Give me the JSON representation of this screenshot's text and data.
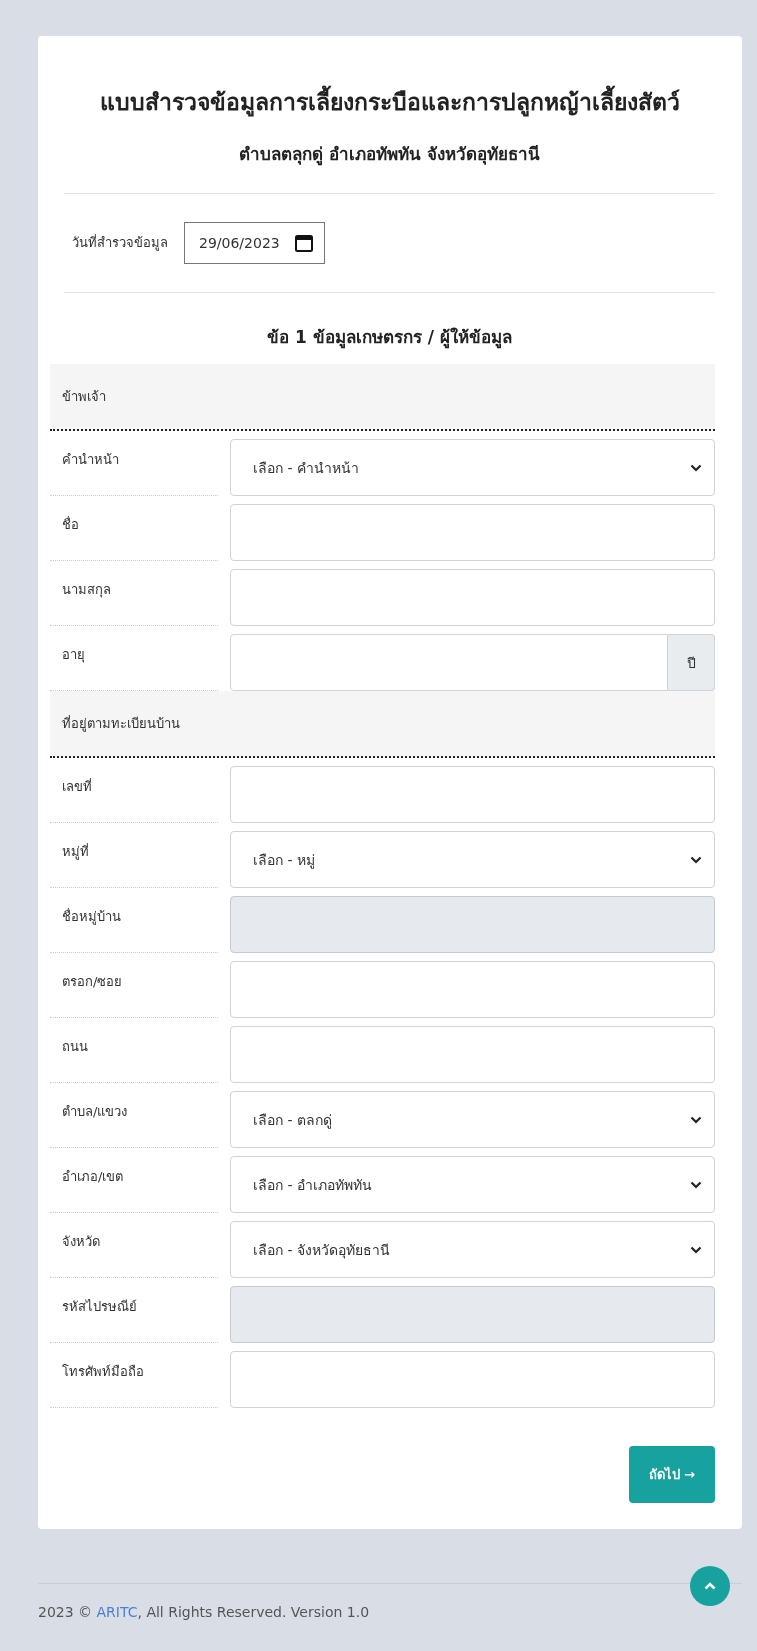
{
  "title": "แบบสำรวจข้อมูลการเลี้ยงกระบือและการปลูกหญ้าเลี้ยงสัตว์",
  "subtitle": "ตำบลตลุกดู่ อำเภอทัพทัน จังหวัดอุทัยธานี",
  "survey_date": {
    "label": "วันที่สำรวจข้อมูล",
    "value": "29/06/2023"
  },
  "section_title": "ข้อ 1 ข้อมูลเกษตรกร / ผู้ให้ข้อมูล",
  "groups": [
    {
      "title": "ข้าพเจ้า",
      "fields": [
        {
          "label": "คำนำหน้า",
          "kind": "select",
          "value": "เลือก - คำนำหน้า"
        },
        {
          "label": "ชื่อ",
          "kind": "text",
          "disabled": false
        },
        {
          "label": "นามสกุล",
          "kind": "text",
          "disabled": false
        },
        {
          "label": "อายุ",
          "kind": "unit",
          "unit": "ปี"
        }
      ]
    },
    {
      "title": "ที่อยู่ตามทะเบียนบ้าน",
      "fields": [
        {
          "label": "เลขที่",
          "kind": "text",
          "disabled": false
        },
        {
          "label": "หมู่ที่",
          "kind": "select",
          "value": "เลือก - หมู่"
        },
        {
          "label": "ชื่อหมู่บ้าน",
          "kind": "text",
          "disabled": true
        },
        {
          "label": "ตรอก/ซอย",
          "kind": "text",
          "disabled": false
        },
        {
          "label": "ถนน",
          "kind": "text",
          "disabled": false
        },
        {
          "label": "ตำบล/แขวง",
          "kind": "select",
          "value": "เลือก - ตลกดู่"
        },
        {
          "label": "อำเภอ/เขต",
          "kind": "select",
          "value": "เลือก - อำเภอทัพทัน"
        },
        {
          "label": "จังหวัด",
          "kind": "select",
          "value": "เลือก - จังหวัดอุทัยธานี"
        },
        {
          "label": "รหัสไปรษณีย์",
          "kind": "text",
          "disabled": true
        },
        {
          "label": "โทรศัพท์มือถือ",
          "kind": "text",
          "disabled": false
        }
      ]
    }
  ],
  "next_button": "ถัดไป →",
  "footer": {
    "prefix": "2023 © ",
    "link": "ARITC",
    "suffix": ", All Rights Reserved. Version 1.0"
  }
}
